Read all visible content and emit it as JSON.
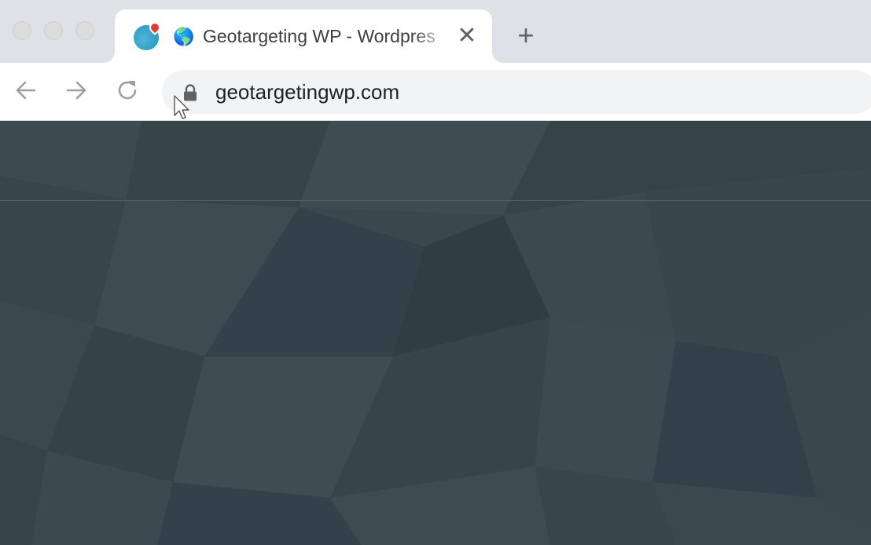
{
  "window": {
    "controls": [
      "close",
      "minimize",
      "zoom"
    ]
  },
  "tabs": [
    {
      "title": "Geotargeting WP - Wordpres",
      "extension_icon": "map-pin-globe-icon",
      "favicon": "earth-globe-icon",
      "favicon_glyph": "🌎",
      "close_glyph": "✕"
    }
  ],
  "new_tab_glyph": "+",
  "toolbar": {
    "back_icon": "arrow-left-icon",
    "forward_icon": "arrow-right-icon",
    "reload_icon": "reload-icon"
  },
  "omnibox": {
    "url": "geotargetingwp.com",
    "lock_icon": "lock-icon"
  },
  "colors": {
    "tabstrip_bg": "#dee1e6",
    "page_bg": "#3a474f",
    "extension_teal": "#2f9dc4",
    "pin_red": "#e53935"
  }
}
